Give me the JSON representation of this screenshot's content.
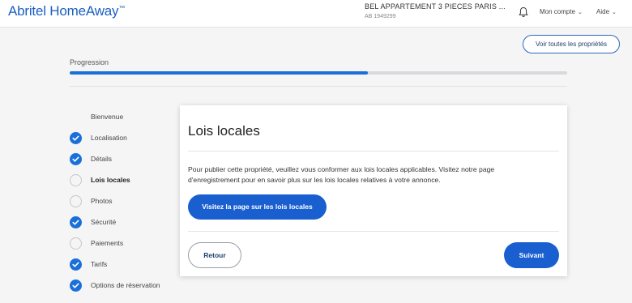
{
  "header": {
    "brand": "Abritel HomeAway",
    "brand_tm": "™",
    "property_title": "BEL APPARTEMENT 3 PIECES PARIS ...",
    "property_id": "AB 1949299",
    "account_label": "Mon compte",
    "help_label": "Aide"
  },
  "see_all_label": "Voir toutes les propriétés",
  "progress": {
    "label": "Progression",
    "fraction": 0.6
  },
  "steps": [
    {
      "label": "Bienvenue",
      "state": "none"
    },
    {
      "label": "Localisation",
      "state": "done"
    },
    {
      "label": "Détails",
      "state": "done"
    },
    {
      "label": "Lois locales",
      "state": "current"
    },
    {
      "label": "Photos",
      "state": "todo"
    },
    {
      "label": "Sécurité",
      "state": "done"
    },
    {
      "label": "Paiements",
      "state": "todo"
    },
    {
      "label": "Tarifs",
      "state": "done"
    },
    {
      "label": "Options de réservation",
      "state": "done"
    }
  ],
  "card": {
    "title": "Lois locales",
    "body": "Pour publier cette propriété, veuillez vous conformer aux lois locales applicables. Visitez notre page d'enregistrement pour en savoir plus sur les lois locales relatives à votre annonce.",
    "link_button": "Visitez la page sur les lois locales",
    "back_button": "Retour",
    "next_button": "Suivant"
  },
  "colors": {
    "accent": "#1a6fd8",
    "brand": "#1b5fc1"
  }
}
